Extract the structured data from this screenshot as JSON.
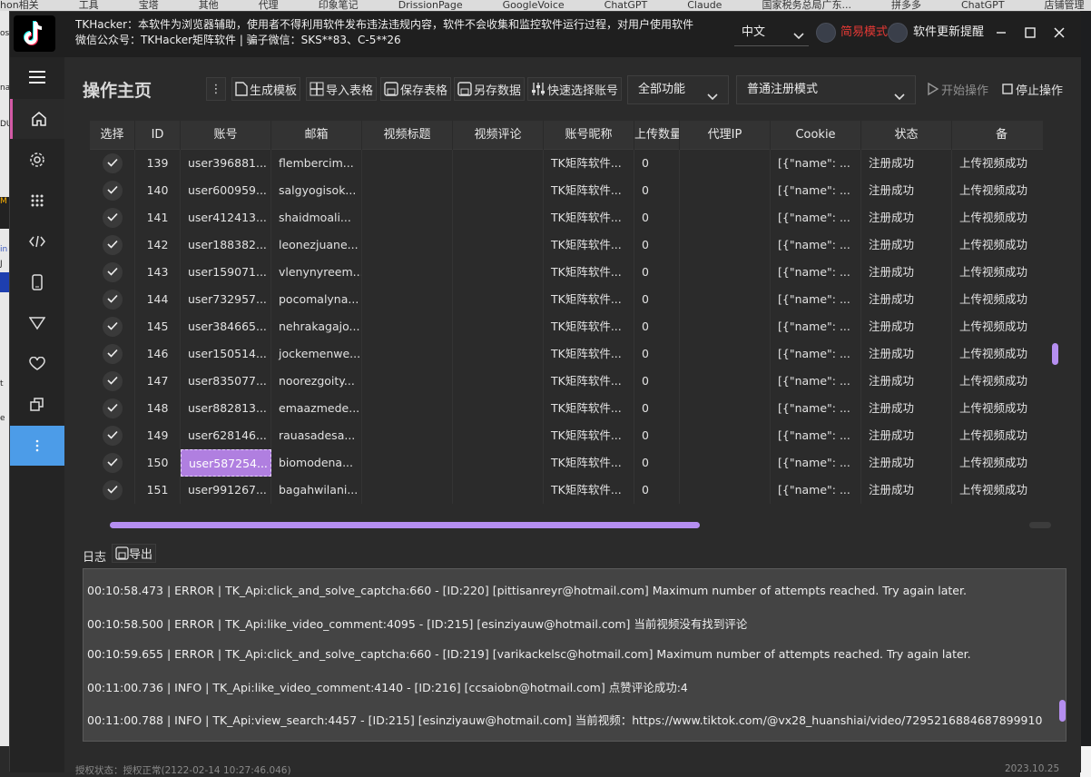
{
  "background": {
    "top_bookmarks": [
      "hon相关",
      "工具",
      "宝塔",
      "其他",
      "代理",
      "印象笔记",
      "DrissionPage",
      "GoogleVoice",
      "ChatGPT",
      "Claude",
      "国家税务总局广东...",
      "拼多多",
      "ChatGPT",
      "店铺管理"
    ],
    "side_fragments": [
      "os",
      "na",
      "DU",
      "M",
      "in",
      "J",
      "t",
      "e"
    ]
  },
  "titlebar": {
    "notice_line1": "TKHacker：本软件为浏览器辅助，使用者不得利用软件发布违法违规内容，软件不会收集和监控软件运行过程，对用户使用软件",
    "notice_line2": "微信公众号：TKHacker矩阵软件 | 骗子微信：SKS**83、C-5**26",
    "language": "中文",
    "simple_mode_label": "简易模式",
    "update_label": "软件更新提醒",
    "simple_mode_color": "#e53935"
  },
  "sidebar": {
    "icons": [
      "menu-icon",
      "home-icon",
      "gear-icon",
      "grid-icon",
      "code-icon",
      "phone-icon",
      "triangle-icon",
      "heart-icon",
      "copy-icon",
      "more-icon"
    ]
  },
  "main": {
    "title": "操作主页",
    "toolbar": {
      "more": "⋮",
      "create_template": "生成模板",
      "import_table": "导入表格",
      "save_table": "保存表格",
      "save_data_as": "另存数据",
      "quick_select": "快速选择账号",
      "function_select": "全部功能",
      "mode_select": "普通注册模式",
      "start": "开始操作",
      "stop": "停止操作"
    },
    "table": {
      "headers": [
        "选择",
        "ID",
        "账号",
        "邮箱",
        "视频标题",
        "视频评论",
        "账号昵称",
        "上传数量",
        "代理IP",
        "Cookie",
        "状态",
        "备"
      ],
      "rows": [
        {
          "id": "139",
          "account": "user396881...",
          "email": "flembercim...",
          "title": "",
          "comment": "",
          "nick": "TK矩阵软件...",
          "count": "0",
          "proxy": "",
          "cookie": "[{\"name\": ...",
          "status": "注册成功",
          "remark": "上传视频成功"
        },
        {
          "id": "140",
          "account": "user600959...",
          "email": "salgyogisok...",
          "title": "",
          "comment": "",
          "nick": "TK矩阵软件...",
          "count": "0",
          "proxy": "",
          "cookie": "[{\"name\": ...",
          "status": "注册成功",
          "remark": "上传视频成功"
        },
        {
          "id": "141",
          "account": "user412413...",
          "email": "shaidmoali...",
          "title": "",
          "comment": "",
          "nick": "TK矩阵软件...",
          "count": "0",
          "proxy": "",
          "cookie": "[{\"name\": ...",
          "status": "注册成功",
          "remark": "上传视频成功"
        },
        {
          "id": "142",
          "account": "user188382...",
          "email": "leonezjuane...",
          "title": "",
          "comment": "",
          "nick": "TK矩阵软件...",
          "count": "0",
          "proxy": "",
          "cookie": "[{\"name\": ...",
          "status": "注册成功",
          "remark": "上传视频成功"
        },
        {
          "id": "143",
          "account": "user159071...",
          "email": "vlenynyreem...",
          "title": "",
          "comment": "",
          "nick": "TK矩阵软件...",
          "count": "0",
          "proxy": "",
          "cookie": "[{\"name\": ...",
          "status": "注册成功",
          "remark": "上传视频成功"
        },
        {
          "id": "144",
          "account": "user732957...",
          "email": "pocomalyna...",
          "title": "",
          "comment": "",
          "nick": "TK矩阵软件...",
          "count": "0",
          "proxy": "",
          "cookie": "[{\"name\": ...",
          "status": "注册成功",
          "remark": "上传视频成功"
        },
        {
          "id": "145",
          "account": "user384665...",
          "email": "nehrakagajo...",
          "title": "",
          "comment": "",
          "nick": "TK矩阵软件...",
          "count": "0",
          "proxy": "",
          "cookie": "[{\"name\": ...",
          "status": "注册成功",
          "remark": "上传视频成功"
        },
        {
          "id": "146",
          "account": "user150514...",
          "email": "jockemenwe...",
          "title": "",
          "comment": "",
          "nick": "TK矩阵软件...",
          "count": "0",
          "proxy": "",
          "cookie": "[{\"name\": ...",
          "status": "注册成功",
          "remark": "上传视频成功"
        },
        {
          "id": "147",
          "account": "user835077...",
          "email": "noorezgoity...",
          "title": "",
          "comment": "",
          "nick": "TK矩阵软件...",
          "count": "0",
          "proxy": "",
          "cookie": "[{\"name\": ...",
          "status": "注册成功",
          "remark": "上传视频成功"
        },
        {
          "id": "148",
          "account": "user882813...",
          "email": "emaazmede...",
          "title": "",
          "comment": "",
          "nick": "TK矩阵软件...",
          "count": "0",
          "proxy": "",
          "cookie": "[{\"name\": ...",
          "status": "注册成功",
          "remark": "上传视频成功"
        },
        {
          "id": "149",
          "account": "user628146...",
          "email": "rauasadesa...",
          "title": "",
          "comment": "",
          "nick": "TK矩阵软件...",
          "count": "0",
          "proxy": "",
          "cookie": "[{\"name\": ...",
          "status": "注册成功",
          "remark": "上传视频成功"
        },
        {
          "id": "150",
          "account": "user587254...",
          "email": "biomodena...",
          "title": "",
          "comment": "",
          "nick": "TK矩阵软件...",
          "count": "0",
          "proxy": "",
          "cookie": "[{\"name\": ...",
          "status": "注册成功",
          "remark": "上传视频成功",
          "selected": true
        },
        {
          "id": "151",
          "account": "user991267...",
          "email": "bagahwilani...",
          "title": "",
          "comment": "",
          "nick": "TK矩阵软件...",
          "count": "0",
          "proxy": "",
          "cookie": "[{\"name\": ...",
          "status": "注册成功",
          "remark": "上传视频成功"
        }
      ]
    },
    "log": {
      "title": "日志",
      "export": "导出",
      "lines": [
        "00:10:58.473 | ERROR    | TK_Api:click_and_solve_captcha:660 - [ID:220] [pittisanreyr@hotmail.com] Maximum number of attempts reached. Try again later.",
        "00:10:58.500 | ERROR    | TK_Api:like_video_comment:4095 - [ID:215] [esinziyauw@hotmail.com] 当前视频没有找到评论",
        "00:10:59.655 | ERROR    | TK_Api:click_and_solve_captcha:660 - [ID:219] [varikackelsc@hotmail.com] Maximum number of attempts reached. Try again later.",
        "00:11:00.736 | INFO     | TK_Api:like_video_comment:4140 - [ID:216] [ccsaiobn@hotmail.com] 点赞评论成功:4",
        "00:11:00.788 | INFO     | TK_Api:view_search:4457 - [ID:215] [esinziyauw@hotmail.com] 当前视频：https://www.tiktok.com/@vx28_huanshiai/video/7295216884687899910"
      ]
    },
    "status_text": "授权状态：授权正常(2122-02-14 10:27:46.046)",
    "version": "2023.10.25"
  },
  "colors": {
    "accent": "#b58ef0",
    "active_sidebar": "#4c9ce8",
    "home_indicator": "#d35aa6"
  }
}
